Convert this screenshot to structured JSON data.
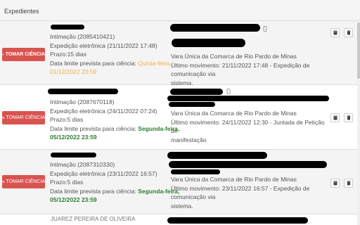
{
  "header": {
    "title": "Expedientes"
  },
  "button_label": "TOMAR CIÊNCIA",
  "deadline_label": "Data limite prevista para ciência:",
  "colors": {
    "button": "#d9534f",
    "deadline_orange": "#f0ad4e",
    "deadline_green": "#2e7d32"
  },
  "icons": {
    "button": "search-icon",
    "actions": [
      "book-icon",
      "trash-icon"
    ],
    "attachment": "paperclip-icon"
  },
  "items": [
    {
      "intimacao": "Intimação (2085410421)",
      "expedicao": "Expedição eletrônica (21/11/2022 17:48)",
      "prazo": "Prazo:15 dias",
      "deadline_day": "Quinta-feira,",
      "deadline_date": "01/12/2022 23:59",
      "deadline_color": "orange",
      "vara": "Vara Única da Comarca de Rio Pardo de Minas",
      "movimento": "Último movimento: 21/11/2022 17:48 - Expedição de comunicação via",
      "movimento_2": "sistema."
    },
    {
      "intimacao": "Intimação (2087670118)",
      "expedicao": "Expedição eletrônica (24/11/2022 07:24)",
      "prazo": "Prazo:5 dias",
      "deadline_day": "Segunda-feira,",
      "deadline_date": "05/12/2022 23:59",
      "deadline_color": "green",
      "vara": "Vara Única da Comarca de Rio Pardo de Minas",
      "movimento": "Último movimento: 24/11/2022 12:30 - Juntada de Petição de",
      "movimento_2": "manifestação"
    },
    {
      "intimacao": "Intimação (2087310330)",
      "expedicao": "Expedição eletrônica (23/11/2022 16:57)",
      "prazo": "Prazo:5 dias",
      "deadline_day": "Segunda-feira,",
      "deadline_date": "05/12/2022 23:59",
      "deadline_color": "green",
      "vara": "Vara Única da Comarca de Rio Pardo de Minas",
      "movimento": "Último movimento: 23/11/2022 16:57 - Expedição de comunicação via",
      "movimento_2": "sistema."
    },
    {
      "partial_name": "JUAREZ PEREIRA DE OLIVEIRA"
    }
  ]
}
